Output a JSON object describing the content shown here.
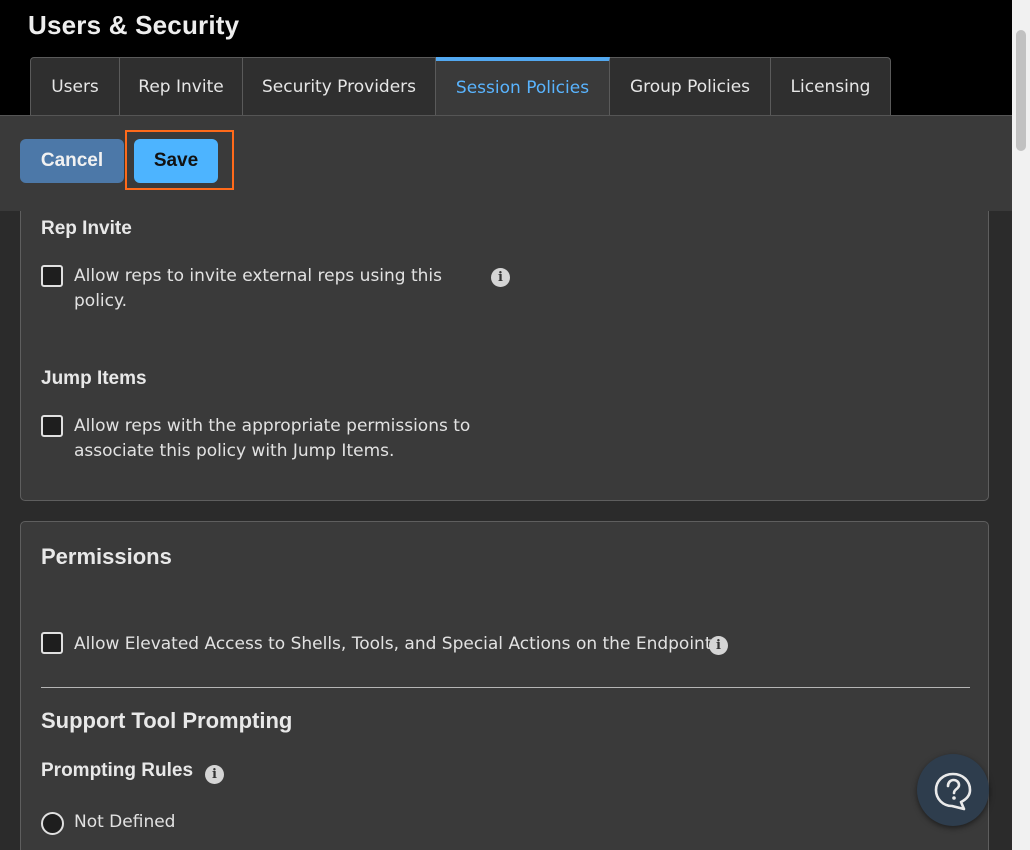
{
  "app": {
    "title": "Users & Security"
  },
  "tabs": [
    {
      "label": "Users",
      "active": false
    },
    {
      "label": "Rep Invite",
      "active": false
    },
    {
      "label": "Security Providers",
      "active": false
    },
    {
      "label": "Session Policies",
      "active": true
    },
    {
      "label": "Group Policies",
      "active": false
    },
    {
      "label": "Licensing",
      "active": false
    }
  ],
  "actions": {
    "cancel_label": "Cancel",
    "save_label": "Save"
  },
  "rep_invite": {
    "title": "Rep Invite",
    "checkbox_label_line1": "Allow reps to invite external reps using this",
    "checkbox_label_line2": "policy.",
    "checked": false
  },
  "jump_items": {
    "title": "Jump Items",
    "checkbox_label_line1": "Allow reps with the appropriate permissions to",
    "checkbox_label_line2": "associate this policy with Jump Items.",
    "checked": false
  },
  "permissions": {
    "title": "Permissions",
    "elevated_label": "Allow Elevated Access to Shells, Tools, and Special Actions on the Endpoint.",
    "checked": false
  },
  "support_tool_prompting": {
    "title": "Support Tool Prompting",
    "rules_title": "Prompting Rules",
    "option_not_defined": "Not Defined"
  },
  "icons": {
    "info": "info-icon",
    "help": "help-chat-icon"
  },
  "colors": {
    "accent": "#52a8f0",
    "save_bg": "#4db4ff",
    "cancel_bg": "#4c78a8",
    "highlight": "#ff6a1a"
  }
}
